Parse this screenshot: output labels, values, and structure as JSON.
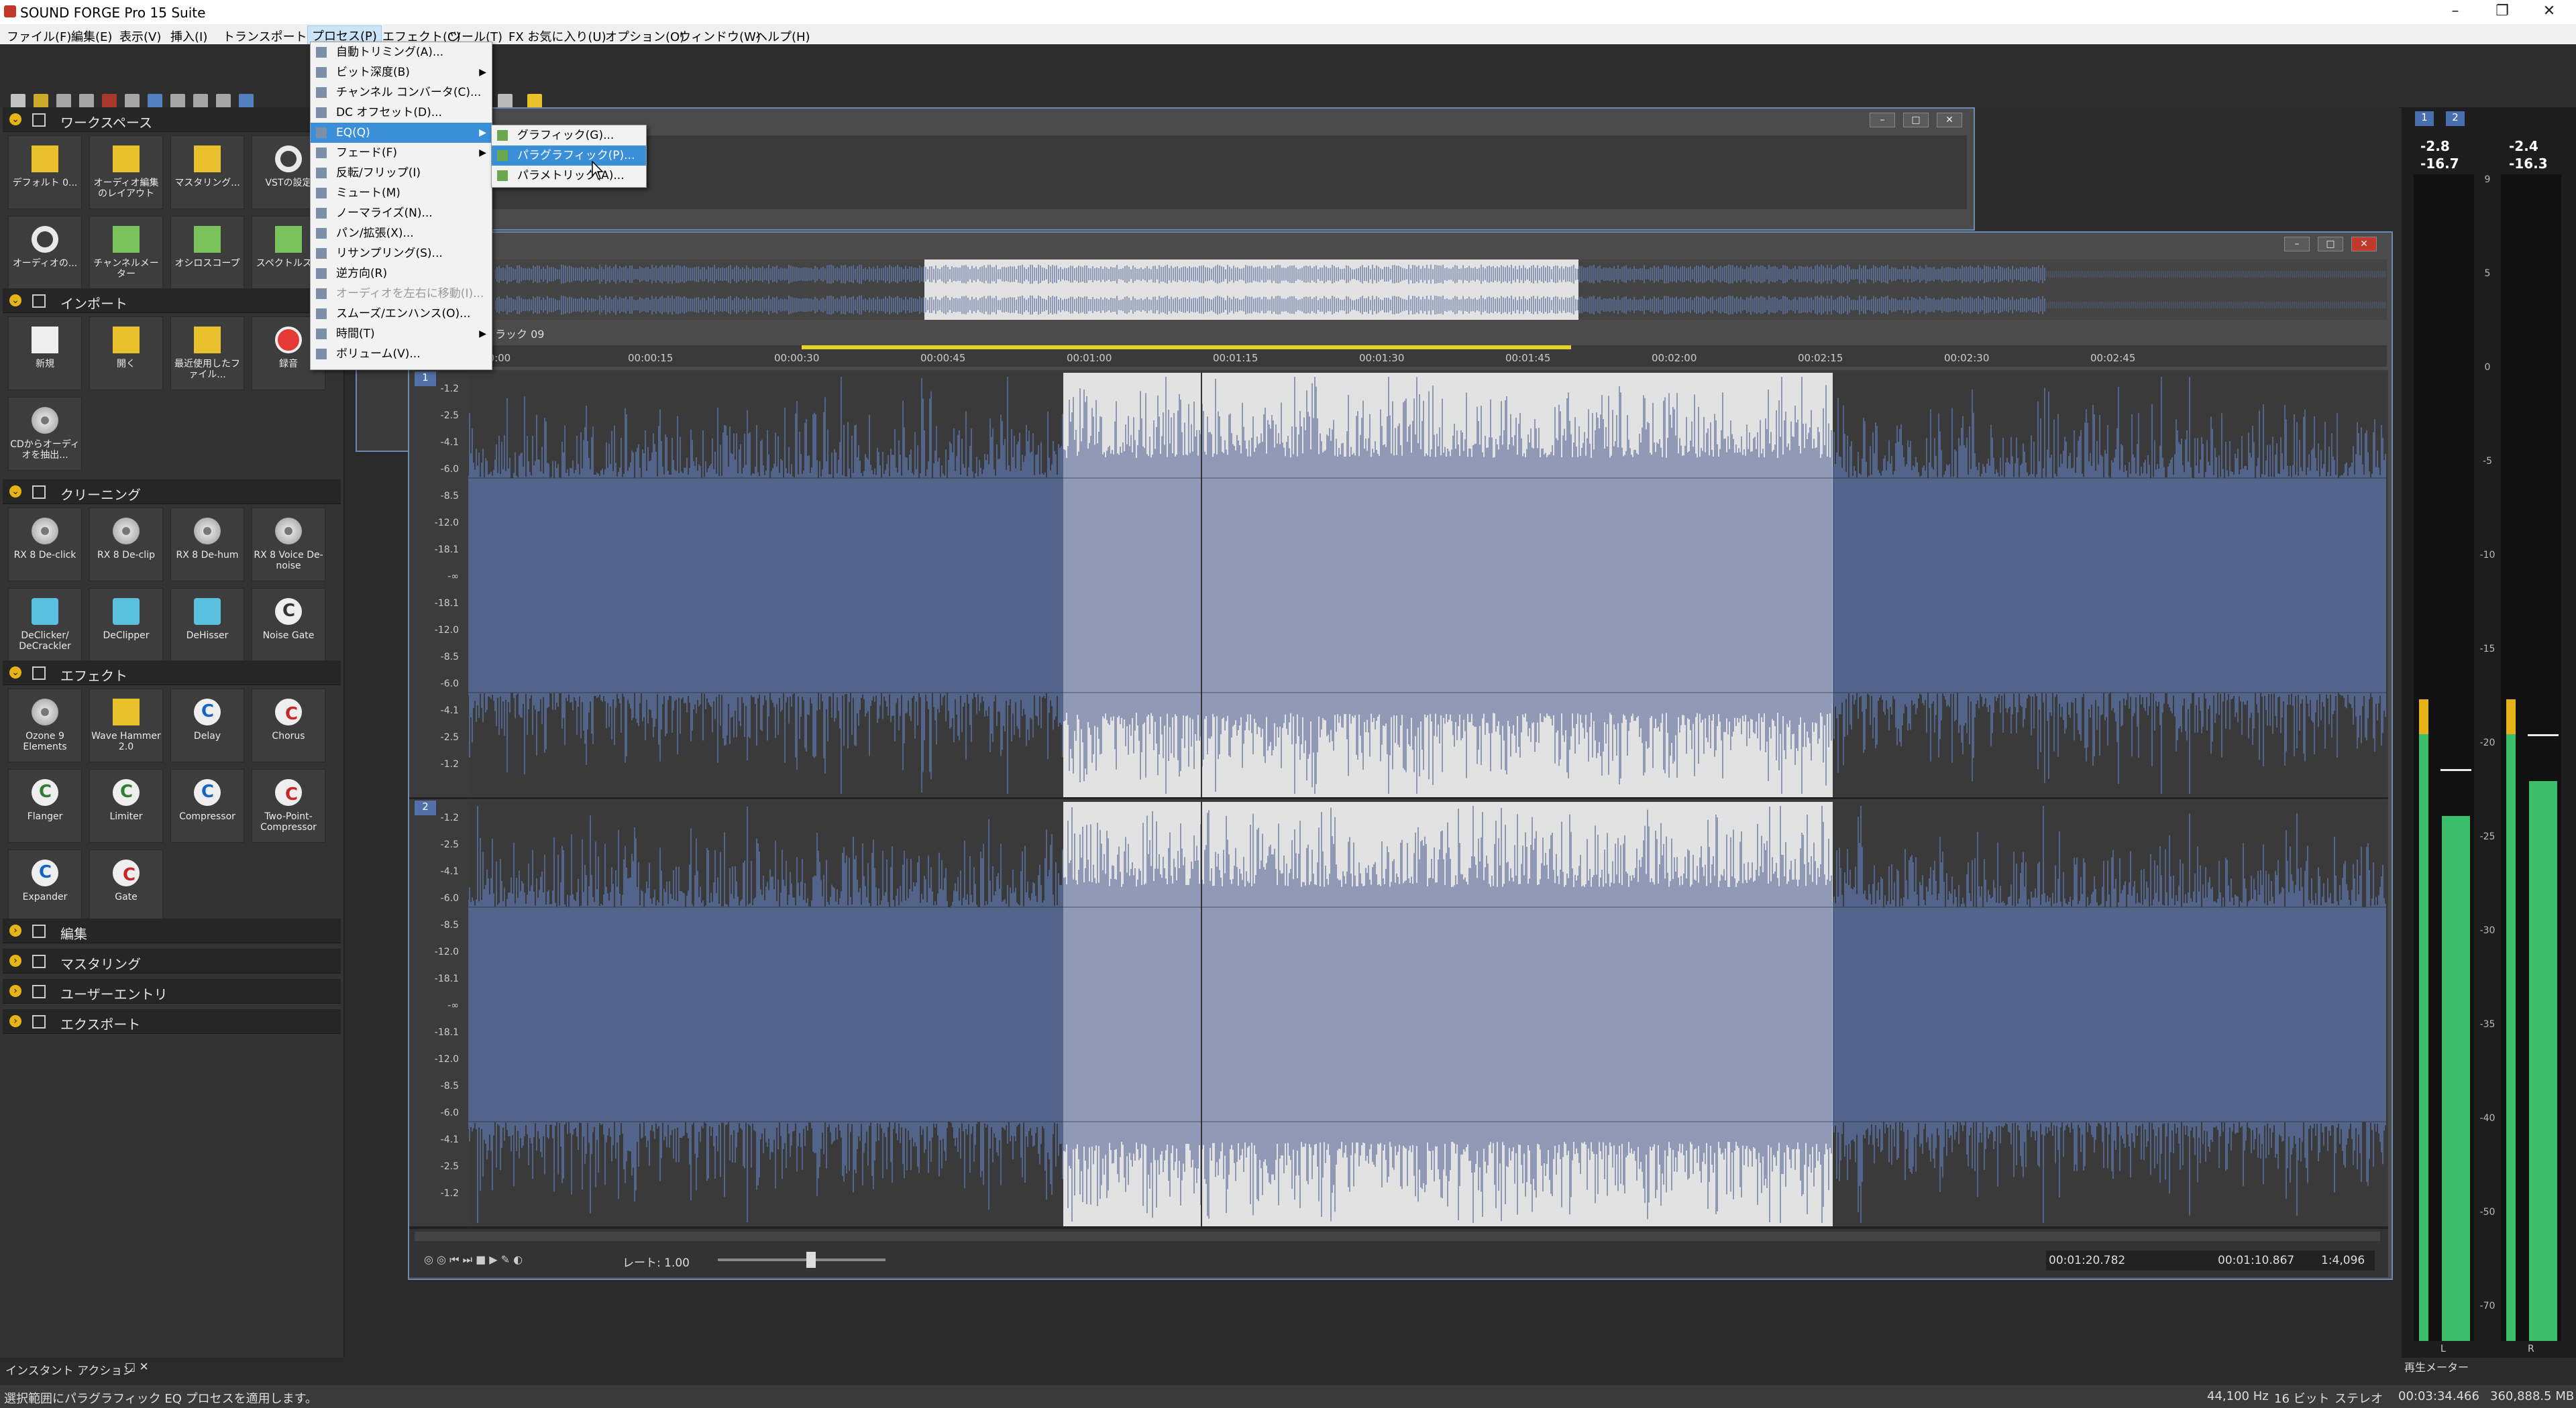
{
  "app": {
    "title": "SOUND FORGE Pro 15 Suite"
  },
  "menubar": [
    "ファイル(F)",
    "編集(E)",
    "表示(V)",
    "挿入(I)",
    "トランスポート(A)",
    "プロセス(P)",
    "エフェクト(C)",
    "ツール(T)",
    "FX お気に入り(U)",
    "オプション(O)",
    "ウィンドウ(W)",
    "ヘルプ(H)"
  ],
  "process_menu": [
    {
      "label": "自動トリミング(A)...",
      "disabled": false,
      "submenu": false
    },
    {
      "label": "ビット深度(B)",
      "disabled": false,
      "submenu": true
    },
    {
      "label": "チャンネル コンバータ(C)...",
      "disabled": false,
      "submenu": false
    },
    {
      "label": "DC オフセット(D)...",
      "disabled": false,
      "submenu": false
    },
    {
      "label": "EQ(Q)",
      "disabled": false,
      "submenu": true,
      "highlighted": true
    },
    {
      "label": "フェード(F)",
      "disabled": false,
      "submenu": true
    },
    {
      "label": "反転/フリップ(I)",
      "disabled": false,
      "submenu": false
    },
    {
      "label": "ミュート(M)",
      "disabled": false,
      "submenu": false
    },
    {
      "label": "ノーマライズ(N)...",
      "disabled": false,
      "submenu": false
    },
    {
      "label": "パン/拡張(X)...",
      "disabled": false,
      "submenu": false
    },
    {
      "label": "リサンプリング(S)...",
      "disabled": false,
      "submenu": false
    },
    {
      "label": "逆方向(R)",
      "disabled": false,
      "submenu": false
    },
    {
      "label": "オーディオを左右に移動(I)...",
      "disabled": true,
      "submenu": false
    },
    {
      "label": "スムーズ/エンハンス(O)...",
      "disabled": false,
      "submenu": false
    },
    {
      "label": "時間(T)",
      "disabled": false,
      "submenu": true
    },
    {
      "label": "ボリューム(V)...",
      "disabled": false,
      "submenu": false
    }
  ],
  "eq_submenu": [
    {
      "label": "グラフィック(G)...",
      "highlighted": false
    },
    {
      "label": "パラグラフィック(P)...",
      "highlighted": true
    },
    {
      "label": "パラメトリック(A)...",
      "highlighted": false
    }
  ],
  "sidebar": {
    "sections": [
      {
        "label": "ワークスペース",
        "tiles": [
          {
            "label": "デフォルト 0...",
            "icon": "layout-icon"
          },
          {
            "label": "オーディオ編集のレイアウト",
            "icon": "layout-icon"
          },
          {
            "label": "マスタリング...",
            "icon": "layout-icon"
          },
          {
            "label": "VSTの設定",
            "icon": "gear-icon"
          },
          {
            "label": "オーディオの...",
            "icon": "gear-icon"
          },
          {
            "label": "チャンネルメーター",
            "icon": "meter-icon"
          },
          {
            "label": "オシロスコープ",
            "icon": "meter-icon"
          },
          {
            "label": "スペクトルス...",
            "icon": "meter-icon"
          }
        ]
      },
      {
        "label": "インポート",
        "tiles": [
          {
            "label": "新規",
            "icon": "new-file-icon"
          },
          {
            "label": "開く",
            "icon": "folder-icon"
          },
          {
            "label": "最近使用したファイル...",
            "icon": "recent-folder-icon"
          },
          {
            "label": "録音",
            "icon": "record-icon"
          },
          {
            "label": "CDからオーディオを抽出...",
            "icon": "cd-icon"
          }
        ]
      },
      {
        "label": "クリーニング",
        "tiles": [
          {
            "label": "RX 8 De-click",
            "icon": "rx-icon"
          },
          {
            "label": "RX 8 De-clip",
            "icon": "rx-icon"
          },
          {
            "label": "RX 8 De-hum",
            "icon": "rx-icon"
          },
          {
            "label": "RX 8 Voice De-noise",
            "icon": "rx-icon"
          },
          {
            "label": "DeClicker/ DeCrackler",
            "icon": "declicker-icon"
          },
          {
            "label": "DeClipper",
            "icon": "declipper-icon"
          },
          {
            "label": "DeHisser",
            "icon": "dehisser-icon"
          },
          {
            "label": "Noise Gate",
            "icon": "noise-gate-icon"
          }
        ]
      },
      {
        "label": "エフェクト",
        "tiles": [
          {
            "label": "Ozone 9 Elements",
            "icon": "ozone-icon"
          },
          {
            "label": "Wave Hammer 2.0",
            "icon": "hammer-icon"
          },
          {
            "label": "Delay",
            "icon": "effect-c-icon"
          },
          {
            "label": "Chorus",
            "icon": "effect-c-icon"
          },
          {
            "label": "Flanger",
            "icon": "effect-c-icon"
          },
          {
            "label": "Limiter",
            "icon": "effect-c-icon"
          },
          {
            "label": "Compressor",
            "icon": "effect-c-icon"
          },
          {
            "label": "Two-Point-Compressor",
            "icon": "effect-c-icon"
          },
          {
            "label": "Expander",
            "icon": "effect-c-icon"
          },
          {
            "label": "Gate",
            "icon": "effect-c-icon"
          }
        ]
      },
      {
        "label": "編集",
        "tiles": []
      },
      {
        "label": "マスタリング",
        "tiles": []
      },
      {
        "label": "ユーザーエントリ",
        "tiles": []
      },
      {
        "label": "エクスポート",
        "tiles": []
      }
    ]
  },
  "data_window": {
    "track_label": "ラック 09",
    "timeline": [
      "00:00",
      "00:00:15",
      "00:00:30",
      "00:00:45",
      "00:01:00",
      "00:01:15",
      "00:01:30",
      "00:01:45",
      "00:02:00",
      "00:02:15",
      "00:02:30",
      "00:02:45"
    ],
    "db_scale": [
      "-1.2",
      "-2.5",
      "-4.1",
      "-6.0",
      "-8.5",
      "-12.0",
      "-18.1",
      "-∞",
      "-18.1",
      "-12.0",
      "-8.5",
      "-6.0",
      "-4.1",
      "-2.5",
      "-1.2"
    ],
    "channels": [
      "1",
      "2"
    ],
    "rate_label": "レート: 1.00",
    "selection_start": "00:01:20.782",
    "selection_length": "00:01:10.867",
    "zoom": "1:4,096"
  },
  "meters": {
    "tabs": [
      "1",
      "2"
    ],
    "peak_left": "-2.8",
    "peak_right": "-2.4",
    "rms_left": "-16.7",
    "rms_right": "-16.3",
    "scale": [
      "9",
      "5",
      "0",
      "-5",
      "-10",
      "-15",
      "-20",
      "-25",
      "-30",
      "-35",
      "-40",
      "-50",
      "-70"
    ],
    "left_level": 0.45,
    "right_level": 0.48,
    "channel_labels": [
      "L",
      "R"
    ],
    "panel_title": "再生メーター"
  },
  "instant_action": "インスタント アクション",
  "status": {
    "message": "選択範囲にパラグラフィック EQ プロセスを適用します。",
    "sample_rate": "44,100 Hz",
    "bit_depth": "16 ビット",
    "channels": "ステレオ",
    "length": "00:03:34.466",
    "free_space": "360,888.5 MB"
  },
  "colors": {
    "wave_light": "#6b8fd8",
    "wave_dark": "#3d5289",
    "selection_bg": "#e2e2e2",
    "menu_hl": "#3b8fd9",
    "meter_green": "#3cbf6a",
    "meter_yellow": "#e5b318"
  }
}
